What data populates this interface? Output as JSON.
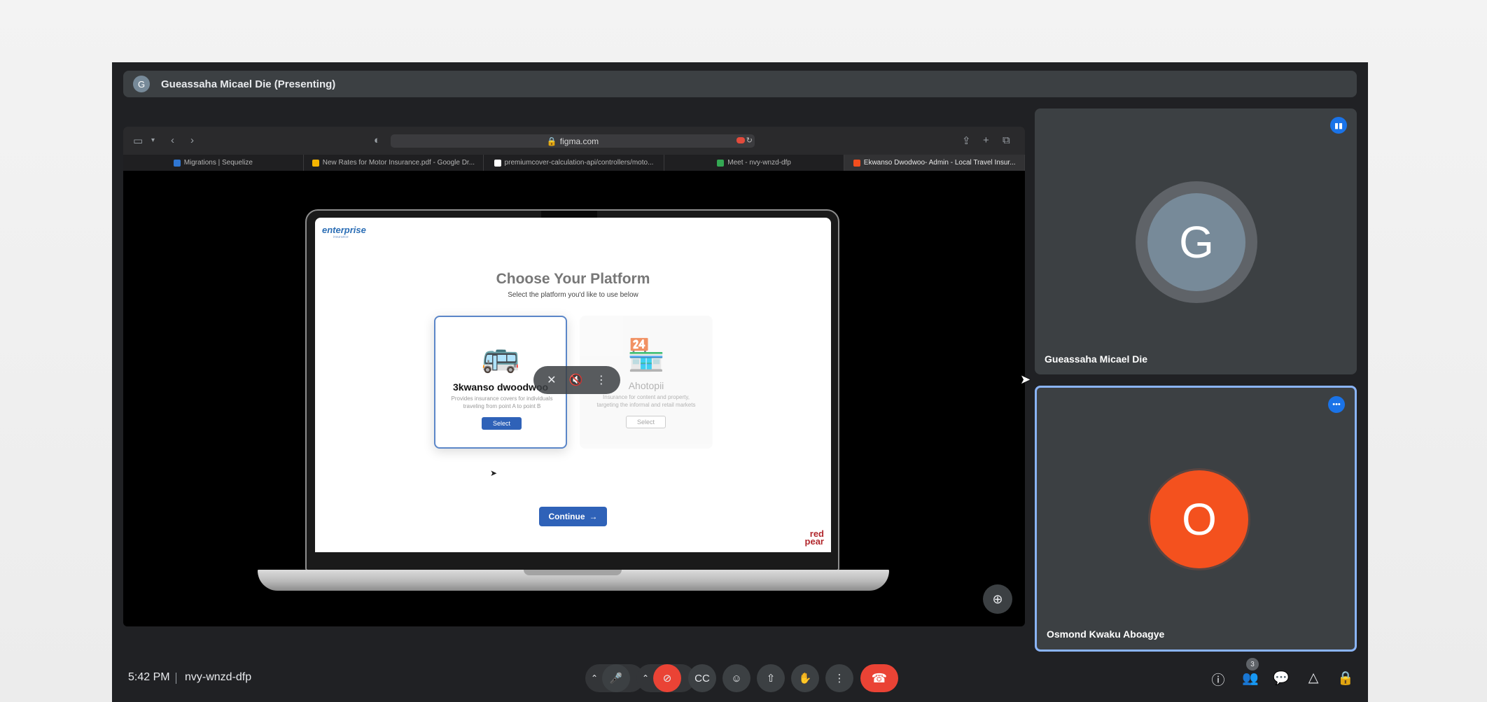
{
  "presenter": {
    "avatar_letter": "G",
    "label": "Gueassaha Micael Die (Presenting)"
  },
  "browser": {
    "url": "figma.com",
    "tabs": [
      {
        "label": "Migrations | Sequelize",
        "color": "#2f76d2"
      },
      {
        "label": "New Rates for Motor Insurance.pdf - Google Dr...",
        "color": "#f4b400"
      },
      {
        "label": "premiumcover-calculation-api/controllers/moto...",
        "color": "#ffffff"
      },
      {
        "label": "Meet - nvy-wnzd-dfp",
        "color": "#34a853"
      },
      {
        "label": "Ekwanso Dwodwoo- Admin - Local Travel Insur...",
        "color": "#f24e1e"
      }
    ]
  },
  "figma_screen": {
    "logo": "enterprise",
    "logo_sub": "insurance",
    "title": "Choose Your Platform",
    "subtitle": "Select the platform you'd like to use below",
    "cards": [
      {
        "icon": "🚌",
        "title": "3kwanso dwoodwoo",
        "desc": "Provides insurance covers for individuals traveling from point A to point B",
        "button": "Select"
      },
      {
        "icon": "🏪",
        "title": "Ahotopii",
        "desc": "Insurance for content and property, targeting the informal and retail markets",
        "button": "Select"
      }
    ],
    "continue_label": "Continue",
    "brand": "red\npear"
  },
  "participants": [
    {
      "name": "Gueassaha Micael Die",
      "letter": "G",
      "color": "#778a99",
      "badge_icon": "audio-level-icon"
    },
    {
      "name": "Osmond Kwaku Aboagye",
      "letter": "O",
      "color": "#f4511e",
      "badge_icon": "more-options-icon"
    }
  ],
  "bottom_bar": {
    "time": "5:42 PM",
    "meeting_code": "nvy-wnzd-dfp",
    "people_count": "3"
  },
  "colors": {
    "meet_bg": "#202124",
    "tile_bg": "#3c4043",
    "danger": "#ea4335",
    "accent": "#8ab4f8"
  }
}
